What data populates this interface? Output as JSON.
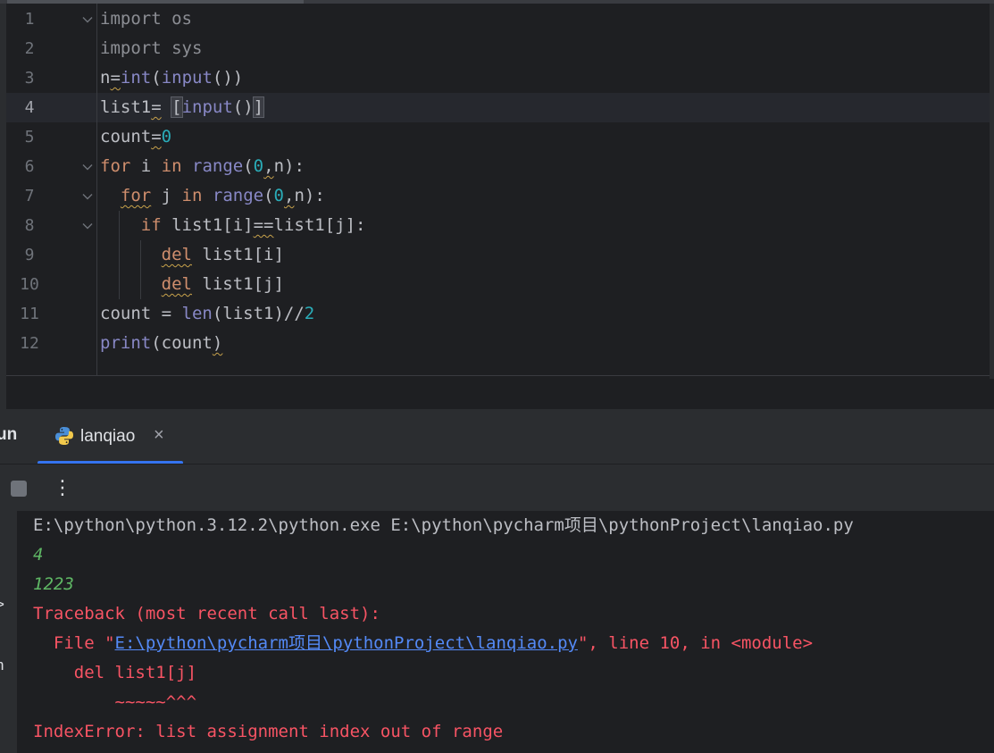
{
  "editor": {
    "current_line": 4,
    "lines": [
      {
        "n": "1",
        "tokens": [
          {
            "t": "import",
            "c": "dim"
          },
          {
            "t": " "
          },
          {
            "t": "os",
            "c": "dim"
          }
        ],
        "fold": true
      },
      {
        "n": "2",
        "tokens": [
          {
            "t": "import",
            "c": "dim"
          },
          {
            "t": " "
          },
          {
            "t": "sys",
            "c": "dim"
          }
        ],
        "fold": false
      },
      {
        "n": "3",
        "tokens": [
          {
            "t": "n"
          },
          {
            "t": "=",
            "w": true
          },
          {
            "t": "int",
            "c": "bi"
          },
          {
            "t": "("
          },
          {
            "t": "input",
            "c": "bi"
          },
          {
            "t": "())"
          }
        ],
        "fold": false
      },
      {
        "n": "4",
        "tokens": [
          {
            "t": "list1"
          },
          {
            "t": "=",
            "w": true
          },
          {
            "t": " "
          },
          {
            "t": "[",
            "m": true
          },
          {
            "t": "input",
            "c": "bi"
          },
          {
            "t": "()"
          },
          {
            "t": "]",
            "m": true
          }
        ],
        "fold": false
      },
      {
        "n": "5",
        "tokens": [
          {
            "t": "count"
          },
          {
            "t": "=",
            "w": true
          },
          {
            "t": "0",
            "c": "num"
          }
        ],
        "fold": false
      },
      {
        "n": "6",
        "tokens": [
          {
            "t": "for",
            "c": "kw"
          },
          {
            "t": " i "
          },
          {
            "t": "in",
            "c": "kw"
          },
          {
            "t": " "
          },
          {
            "t": "range",
            "c": "bi"
          },
          {
            "t": "("
          },
          {
            "t": "0",
            "c": "num"
          },
          {
            "t": ",",
            "w": true
          },
          {
            "t": "n):"
          }
        ],
        "fold": true
      },
      {
        "n": "7",
        "tokens": [
          {
            "t": "  "
          },
          {
            "t": "for",
            "c": "kw",
            "w": true
          },
          {
            "t": " j "
          },
          {
            "t": "in",
            "c": "kw"
          },
          {
            "t": " "
          },
          {
            "t": "range",
            "c": "bi"
          },
          {
            "t": "("
          },
          {
            "t": "0",
            "c": "num"
          },
          {
            "t": ",",
            "w": true
          },
          {
            "t": "n):"
          }
        ],
        "fold": true
      },
      {
        "n": "8",
        "tokens": [
          {
            "t": "    "
          },
          {
            "t": "if",
            "c": "kw"
          },
          {
            "t": " list1[i]"
          },
          {
            "t": "==",
            "w": true
          },
          {
            "t": "list1[j]:"
          }
        ],
        "fold": true
      },
      {
        "n": "9",
        "tokens": [
          {
            "t": "      "
          },
          {
            "t": "del",
            "c": "kw",
            "w": true
          },
          {
            "t": " list1[i]"
          }
        ],
        "fold": false
      },
      {
        "n": "10",
        "tokens": [
          {
            "t": "      "
          },
          {
            "t": "del",
            "c": "kw",
            "w": true
          },
          {
            "t": " list1[j]"
          }
        ],
        "fold": false
      },
      {
        "n": "11",
        "tokens": [
          {
            "t": "count = "
          },
          {
            "t": "len",
            "c": "bi"
          },
          {
            "t": "(list1)//"
          },
          {
            "t": "2",
            "c": "num"
          }
        ],
        "fold": false
      },
      {
        "n": "12",
        "tokens": [
          {
            "t": "print",
            "c": "bi"
          },
          {
            "t": "(count"
          },
          {
            "t": ")",
            "w": true
          }
        ],
        "fold": false
      }
    ]
  },
  "run_panel": {
    "title": "un",
    "tab_label": "lanqiao",
    "tab_close": "×",
    "more_icon": "⋮",
    "rail_glyphs": [
      ">",
      ":",
      "n"
    ]
  },
  "console": {
    "command": "E:\\python\\python.3.12.2\\python.exe E:\\python\\pycharm项目\\pythonProject\\lanqiao.py",
    "input1": "4",
    "input2": "1223",
    "traceback_header": "Traceback (most recent call last):",
    "file_prefix": "  File \"",
    "file_link": "E:\\python\\pycharm项目\\pythonProject\\lanqiao.py",
    "file_suffix": "\", line 10, in <module>",
    "code_line": "    del list1[j]",
    "caret_line": "        ~~~~~^^^",
    "error": "IndexError: list assignment index out of range"
  },
  "colors": {
    "keyword": "#cf8e6d",
    "builtin": "#8888c6",
    "number": "#2aacb8",
    "error": "#f75464",
    "input": "#5fb865",
    "link": "#548af7",
    "tab_accent": "#3574f0"
  }
}
